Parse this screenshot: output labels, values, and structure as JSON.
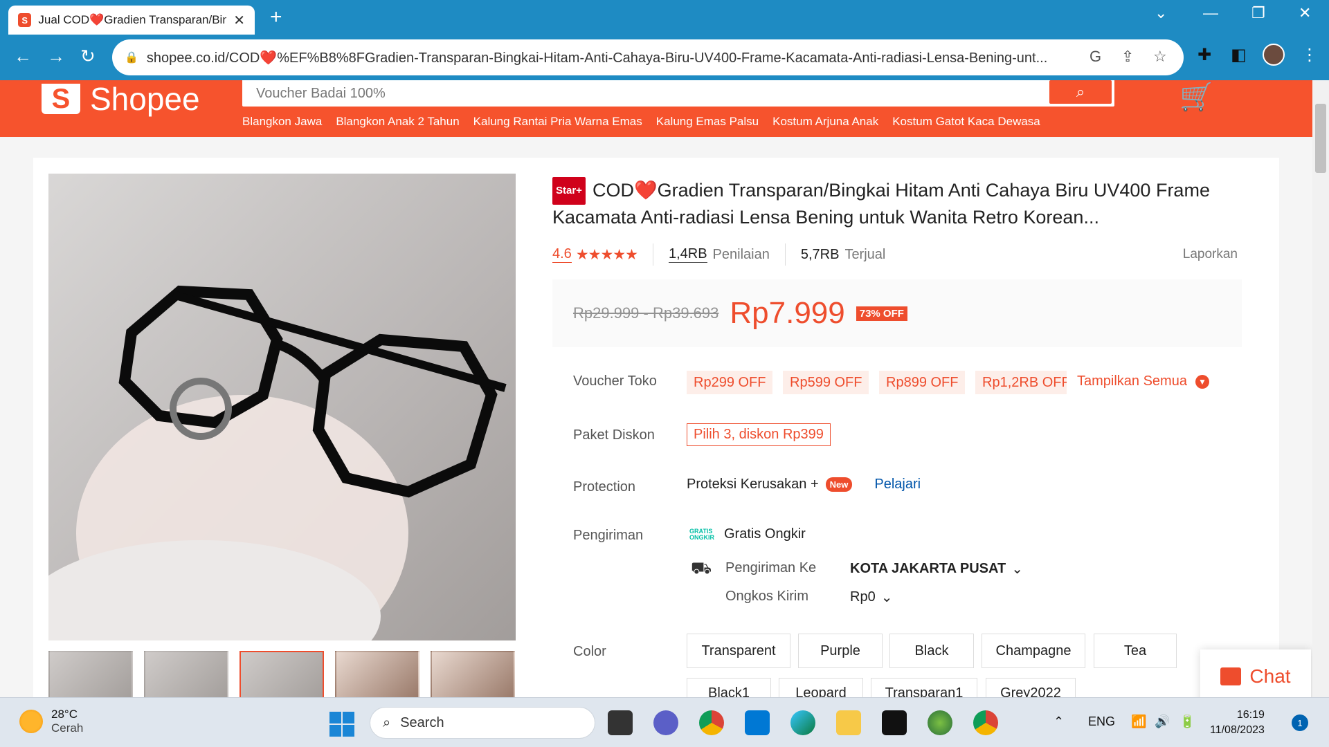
{
  "browser": {
    "tab_title": "Jual COD❤️Gradien Transparan/Bingkai",
    "tab_close": "✕",
    "new_tab": "+",
    "url": "shopee.co.id/COD❤️%EF%B8%8FGradien-Transparan-Bingkai-Hitam-Anti-Cahaya-Biru-UV400-Frame-Kacamata-Anti-radiasi-Lensa-Bening-unt..."
  },
  "header": {
    "logo_text": "Shopee",
    "logo_mark": "S",
    "search_placeholder": "Voucher Badai 100%",
    "keywords": [
      "Blangkon Jawa",
      "Blangkon Anak 2 Tahun",
      "Kalung Rantai Pria Warna Emas",
      "Kalung Emas Palsu",
      "Kostum Arjuna Anak",
      "Kostum Gatot Kaca Dewasa"
    ]
  },
  "product": {
    "badge": "Star+",
    "title": "COD❤️Gradien Transparan/Bingkai Hitam Anti Cahaya Biru UV400 Frame Kacamata Anti-radiasi Lensa Bening untuk Wanita Retro Korean...",
    "rating": "4.6",
    "stars": "★★★★★",
    "reviews_count": "1,4RB",
    "reviews_label": "Penilaian",
    "sold_count": "5,7RB",
    "sold_label": "Terjual",
    "report": "Laporkan",
    "price_original": "Rp29.999 - Rp39.693",
    "price": "Rp7.999",
    "discount": "73% OFF"
  },
  "vouchers": {
    "label": "Voucher Toko",
    "items": [
      "Rp299 OFF",
      "Rp599 OFF",
      "Rp899 OFF",
      "Rp1,2RB OFF"
    ],
    "show_all": "Tampilkan Semua"
  },
  "bundle": {
    "label": "Paket Diskon",
    "value": "Pilih 3, diskon Rp399"
  },
  "protection": {
    "label": "Protection",
    "value": "Proteksi Kerusakan +",
    "badge": "New",
    "learn": "Pelajari"
  },
  "shipping": {
    "label": "Pengiriman",
    "free": "Gratis Ongkir",
    "free_icon": "GRATIS ONGKIR",
    "to_label": "Pengiriman Ke",
    "to_value": "KOTA JAKARTA PUSAT",
    "cost_label": "Ongkos Kirim",
    "cost_value": "Rp0"
  },
  "color": {
    "label": "Color",
    "options_row1": [
      "Transparent",
      "Purple",
      "Black",
      "Champagne",
      "Tea"
    ],
    "options_row2": [
      "Black1",
      "Leopard",
      "Transparan1",
      "Grey2022"
    ]
  },
  "chat": {
    "label": "Chat"
  },
  "taskbar": {
    "temp": "28°C",
    "weather": "Cerah",
    "search": "Search",
    "lang": "ENG",
    "time": "16:19",
    "date": "11/08/2023",
    "notifications": "1"
  },
  "colors": {
    "brand": "#ee4d2d",
    "browser": "#1e8bc3"
  }
}
